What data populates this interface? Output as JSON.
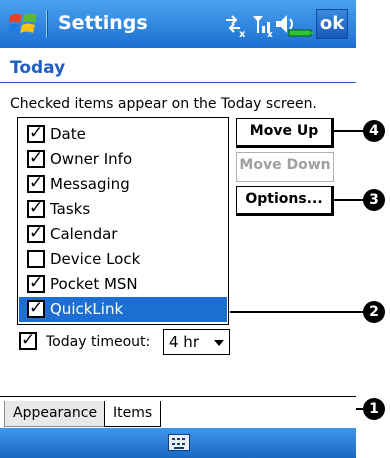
{
  "titlebar": {
    "title": "Settings",
    "status_icons": [
      "connectivity-icon",
      "signal-icon",
      "volume-icon",
      "battery-icon"
    ],
    "ok_label": "ok"
  },
  "page": {
    "header": "Today",
    "instruction": "Checked items appear on the Today screen."
  },
  "items": [
    {
      "label": "Date",
      "checked": true
    },
    {
      "label": "Owner Info",
      "checked": true
    },
    {
      "label": "Messaging",
      "checked": true
    },
    {
      "label": "Tasks",
      "checked": true
    },
    {
      "label": "Calendar",
      "checked": true
    },
    {
      "label": "Device Lock",
      "checked": false
    },
    {
      "label": "Pocket MSN",
      "checked": true
    },
    {
      "label": "QuickLink",
      "checked": true,
      "selected": true
    }
  ],
  "buttons": {
    "move_up": "Move Up",
    "move_down": "Move Down",
    "options": "Options..."
  },
  "timeout": {
    "checked": true,
    "label": "Today timeout:",
    "value": "4 hr"
  },
  "tabs": [
    "Appearance",
    "Items"
  ],
  "callouts": [
    "4",
    "3",
    "2",
    "1"
  ],
  "colors": {
    "titlebar": "#1c6fd0",
    "header": "#1f5fbf",
    "selection": "#1c6fd0"
  }
}
